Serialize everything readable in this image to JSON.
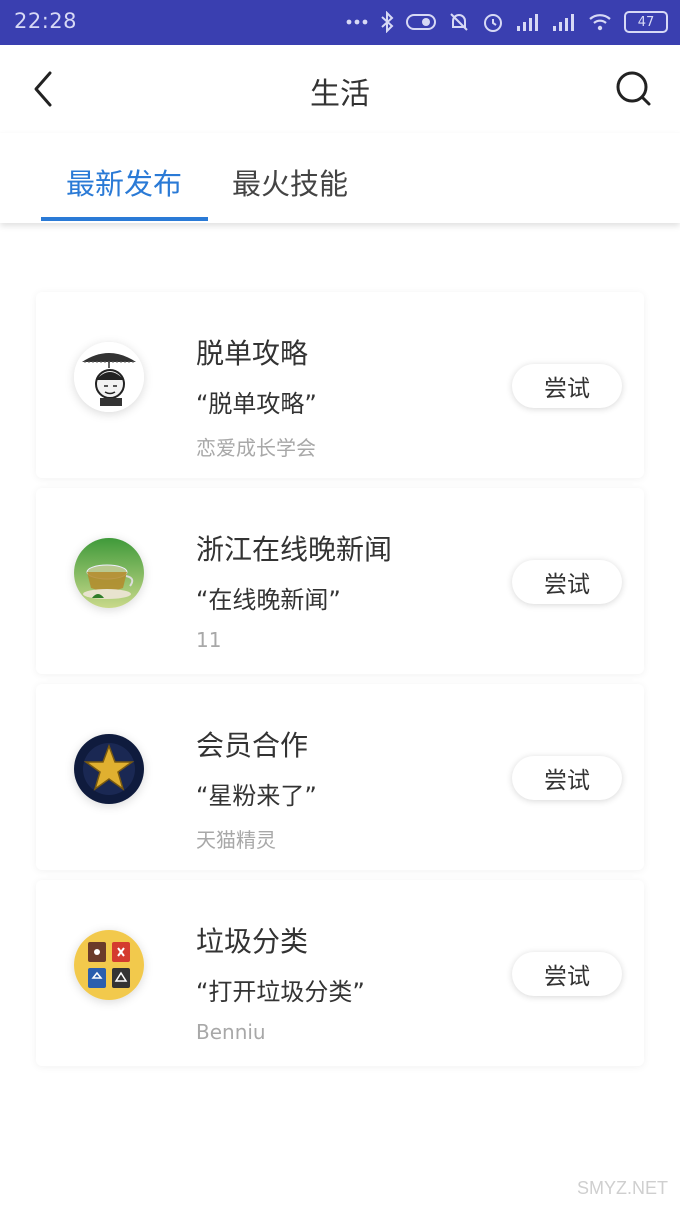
{
  "status_bar": {
    "time": "22:28",
    "battery": "47"
  },
  "header": {
    "title": "生活"
  },
  "tabs": [
    {
      "label": "最新发布",
      "active": true
    },
    {
      "label": "最火技能",
      "active": false
    }
  ],
  "items": [
    {
      "title": "脱单攻略",
      "phrase": "“脱单攻略”",
      "author": "恋爱成长学会",
      "button": "尝试"
    },
    {
      "title": "浙江在线晚新闻",
      "phrase": "“在线晚新闻”",
      "author": "11",
      "button": "尝试"
    },
    {
      "title": "会员合作",
      "phrase": "“星粉来了”",
      "author": "天猫精灵",
      "button": "尝试"
    },
    {
      "title": "垃圾分类",
      "phrase": "“打开垃圾分类”",
      "author": "Benniu",
      "button": "尝试"
    }
  ],
  "watermark": "SMYZ.NET",
  "colors": {
    "status_bar": "#3a3fb0",
    "accent": "#2a7ad6",
    "secondary_text": "#a8a8a8"
  }
}
